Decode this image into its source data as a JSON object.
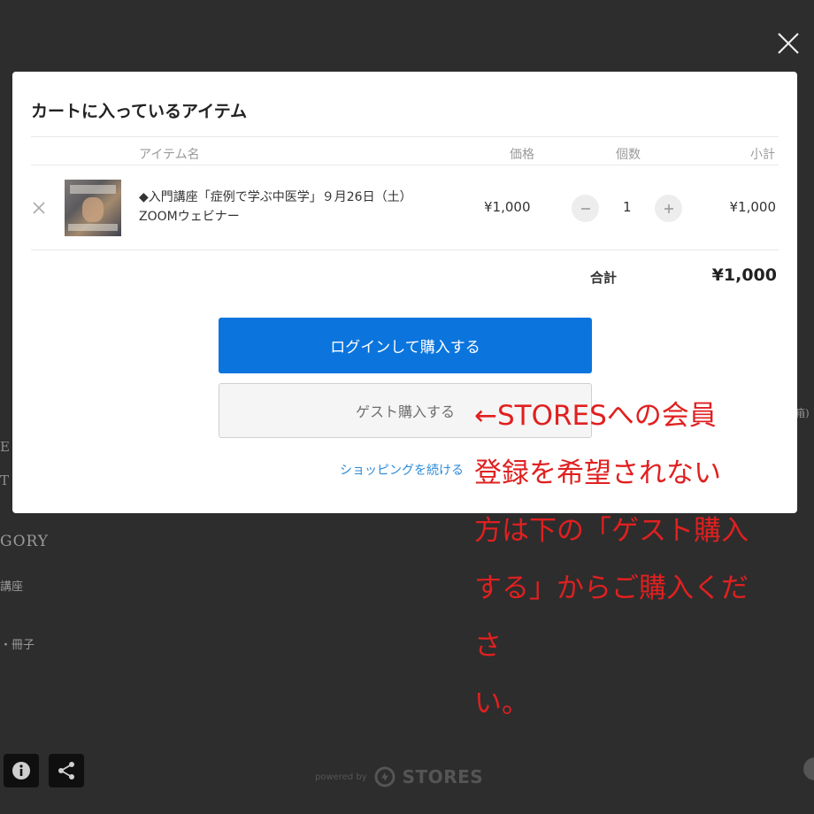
{
  "background": {
    "category_heading": "GORY",
    "category_items": [
      "講座",
      "・冊子"
    ],
    "side_fragments": [
      "E",
      "T",
      "箱)"
    ],
    "footer": {
      "powered_by": "powered by",
      "brand": "STORES"
    }
  },
  "modal": {
    "title": "カートに入っているアイテム",
    "columns": {
      "item": "アイテム名",
      "price": "価格",
      "qty": "個数",
      "subtotal": "小計"
    },
    "items": [
      {
        "name_line1": "◆入門講座「症例で学ぶ中医学」９月26日（土）",
        "name_line2": "ZOOMウェビナー",
        "price": "¥1,000",
        "qty": "1",
        "subtotal": "¥1,000"
      }
    ],
    "total_label": "合計",
    "total_value": "¥1,000",
    "login_button": "ログインして購入する",
    "guest_button": "ゲスト購入する",
    "continue_link": "ショッピングを続ける"
  },
  "annotation": {
    "lines": [
      "←STORESへの会員",
      "登録を希望されない",
      "方は下の「ゲスト購入",
      "する」からご購入くださ",
      "い。"
    ]
  },
  "colors": {
    "accent": "#0b75dd",
    "annotation": "#e02020",
    "overlay": "#2d2d2d"
  }
}
